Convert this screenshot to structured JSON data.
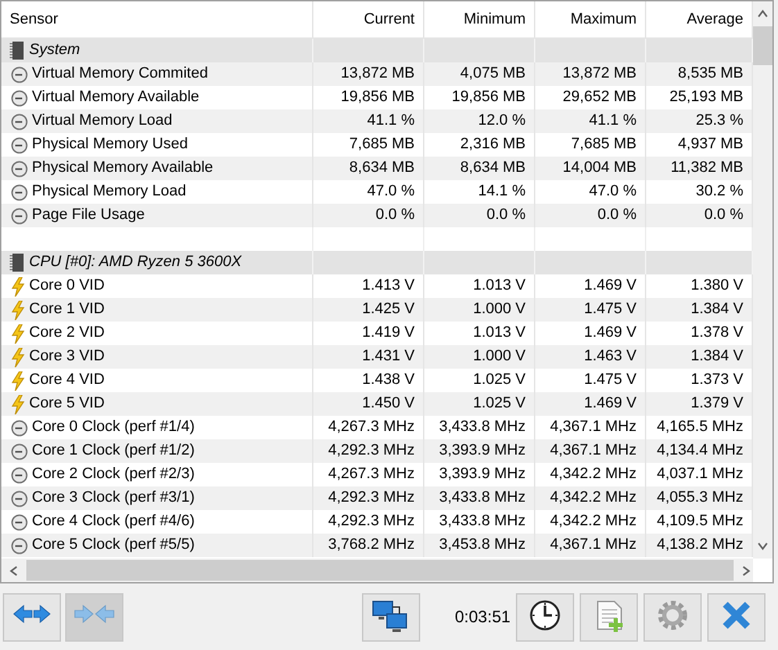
{
  "columns": [
    "Sensor",
    "Current",
    "Minimum",
    "Maximum",
    "Average"
  ],
  "groups": [
    {
      "name": "System",
      "rows": [
        {
          "kind": "gauge",
          "label": "Virtual Memory Commited",
          "values": [
            "13,872 MB",
            "4,075 MB",
            "13,872 MB",
            "8,535 MB"
          ]
        },
        {
          "kind": "gauge",
          "label": "Virtual Memory Available",
          "values": [
            "19,856 MB",
            "19,856 MB",
            "29,652 MB",
            "25,193 MB"
          ]
        },
        {
          "kind": "gauge",
          "label": "Virtual Memory Load",
          "values": [
            "41.1 %",
            "12.0 %",
            "41.1 %",
            "25.3 %"
          ]
        },
        {
          "kind": "gauge",
          "label": "Physical Memory Used",
          "values": [
            "7,685 MB",
            "2,316 MB",
            "7,685 MB",
            "4,937 MB"
          ]
        },
        {
          "kind": "gauge",
          "label": "Physical Memory Available",
          "values": [
            "8,634 MB",
            "8,634 MB",
            "14,004 MB",
            "11,382 MB"
          ]
        },
        {
          "kind": "gauge",
          "label": "Physical Memory Load",
          "values": [
            "47.0 %",
            "14.1 %",
            "47.0 %",
            "30.2 %"
          ]
        },
        {
          "kind": "gauge",
          "label": "Page File Usage",
          "values": [
            "0.0 %",
            "0.0 %",
            "0.0 %",
            "0.0 %"
          ]
        }
      ]
    },
    {
      "name": "CPU [#0]: AMD Ryzen 5 3600X",
      "rows": [
        {
          "kind": "voltage",
          "label": "Core 0 VID",
          "values": [
            "1.413 V",
            "1.013 V",
            "1.469 V",
            "1.380 V"
          ]
        },
        {
          "kind": "voltage",
          "label": "Core 1 VID",
          "values": [
            "1.425 V",
            "1.000 V",
            "1.475 V",
            "1.384 V"
          ]
        },
        {
          "kind": "voltage",
          "label": "Core 2 VID",
          "values": [
            "1.419 V",
            "1.013 V",
            "1.469 V",
            "1.378 V"
          ]
        },
        {
          "kind": "voltage",
          "label": "Core 3 VID",
          "values": [
            "1.431 V",
            "1.000 V",
            "1.463 V",
            "1.384 V"
          ]
        },
        {
          "kind": "voltage",
          "label": "Core 4 VID",
          "values": [
            "1.438 V",
            "1.025 V",
            "1.475 V",
            "1.373 V"
          ]
        },
        {
          "kind": "voltage",
          "label": "Core 5 VID",
          "values": [
            "1.450 V",
            "1.025 V",
            "1.469 V",
            "1.379 V"
          ]
        },
        {
          "kind": "gauge",
          "label": "Core 0 Clock (perf #1/4)",
          "values": [
            "4,267.3 MHz",
            "3,433.8 MHz",
            "4,367.1 MHz",
            "4,165.5 MHz"
          ]
        },
        {
          "kind": "gauge",
          "label": "Core 1 Clock (perf #1/2)",
          "values": [
            "4,292.3 MHz",
            "3,393.9 MHz",
            "4,367.1 MHz",
            "4,134.4 MHz"
          ]
        },
        {
          "kind": "gauge",
          "label": "Core 2 Clock (perf #2/3)",
          "values": [
            "4,267.3 MHz",
            "3,393.9 MHz",
            "4,342.2 MHz",
            "4,037.1 MHz"
          ]
        },
        {
          "kind": "gauge",
          "label": "Core 3 Clock (perf #3/1)",
          "values": [
            "4,292.3 MHz",
            "3,433.8 MHz",
            "4,342.2 MHz",
            "4,055.3 MHz"
          ]
        },
        {
          "kind": "gauge",
          "label": "Core 4 Clock (perf #4/6)",
          "values": [
            "4,292.3 MHz",
            "3,433.8 MHz",
            "4,342.2 MHz",
            "4,109.5 MHz"
          ]
        },
        {
          "kind": "gauge",
          "label": "Core 5 Clock (perf #5/5)",
          "values": [
            "3,768.2 MHz",
            "3,453.8 MHz",
            "4,367.1 MHz",
            "4,138.2 MHz"
          ]
        }
      ]
    }
  ],
  "toolbar_left": [
    {
      "kind": "expand",
      "pressed": false
    },
    {
      "kind": "collapse",
      "pressed": true
    }
  ],
  "elapsed": "0:03:51",
  "toolbar_right": [
    {
      "kind": "network",
      "pressed": false
    }
  ],
  "toolbar_end": [
    {
      "kind": "clock",
      "pressed": false
    },
    {
      "kind": "report",
      "pressed": false
    },
    {
      "kind": "settings",
      "pressed": false
    },
    {
      "kind": "close",
      "pressed": false
    }
  ]
}
